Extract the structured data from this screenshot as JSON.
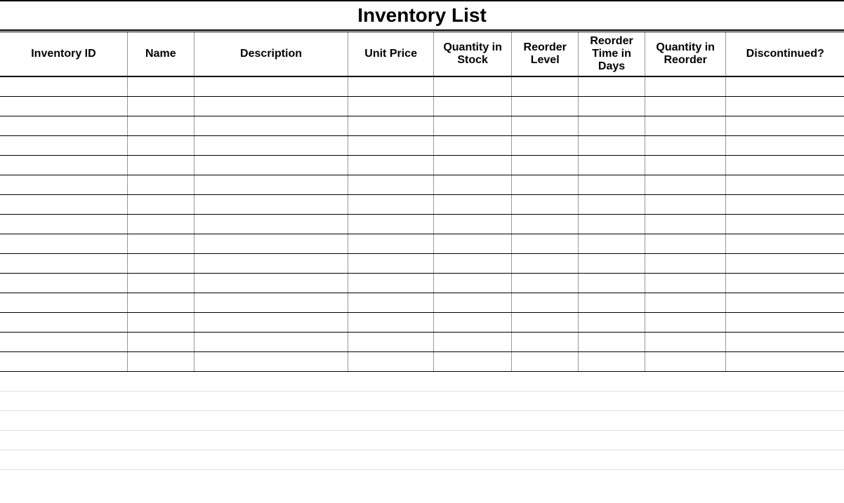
{
  "title": "Inventory List",
  "columns": [
    "Inventory ID",
    "Name",
    "Description",
    "Unit Price",
    "Quantity in Stock",
    "Reorder Level",
    "Reorder Time in Days",
    "Quantity in Reorder",
    "Discontinued?"
  ],
  "rows": [
    [
      "",
      "",
      "",
      "",
      "",
      "",
      "",
      "",
      ""
    ],
    [
      "",
      "",
      "",
      "",
      "",
      "",
      "",
      "",
      ""
    ],
    [
      "",
      "",
      "",
      "",
      "",
      "",
      "",
      "",
      ""
    ],
    [
      "",
      "",
      "",
      "",
      "",
      "",
      "",
      "",
      ""
    ],
    [
      "",
      "",
      "",
      "",
      "",
      "",
      "",
      "",
      ""
    ],
    [
      "",
      "",
      "",
      "",
      "",
      "",
      "",
      "",
      ""
    ],
    [
      "",
      "",
      "",
      "",
      "",
      "",
      "",
      "",
      ""
    ],
    [
      "",
      "",
      "",
      "",
      "",
      "",
      "",
      "",
      ""
    ],
    [
      "",
      "",
      "",
      "",
      "",
      "",
      "",
      "",
      ""
    ],
    [
      "",
      "",
      "",
      "",
      "",
      "",
      "",
      "",
      ""
    ],
    [
      "",
      "",
      "",
      "",
      "",
      "",
      "",
      "",
      ""
    ],
    [
      "",
      "",
      "",
      "",
      "",
      "",
      "",
      "",
      ""
    ],
    [
      "",
      "",
      "",
      "",
      "",
      "",
      "",
      "",
      ""
    ],
    [
      "",
      "",
      "",
      "",
      "",
      "",
      "",
      "",
      ""
    ],
    [
      "",
      "",
      "",
      "",
      "",
      "",
      "",
      "",
      ""
    ]
  ],
  "faint_row_count": 5
}
